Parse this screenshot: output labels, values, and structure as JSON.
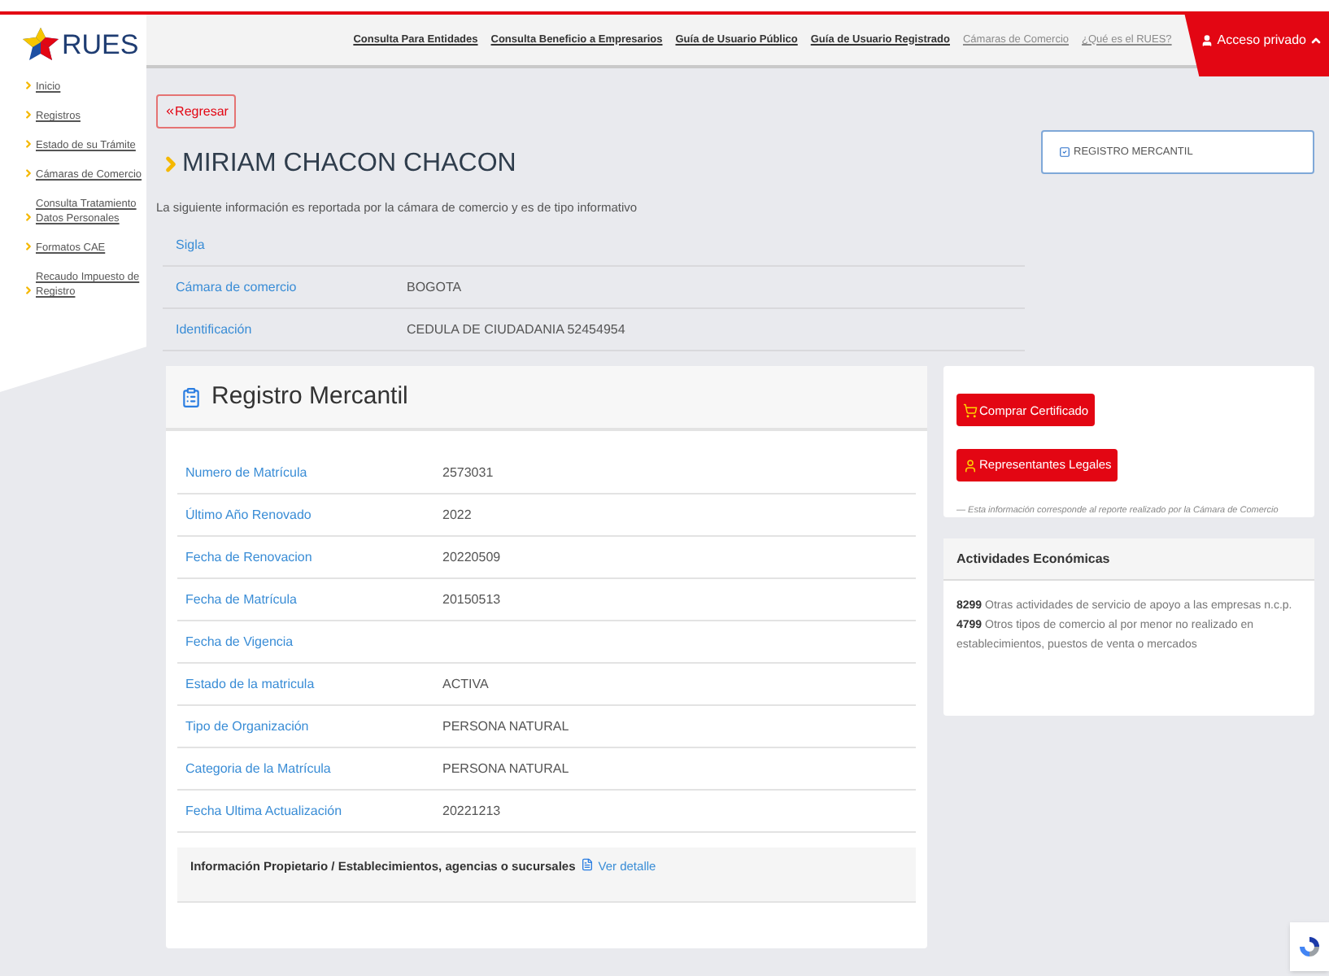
{
  "logo": {
    "text": "RUES"
  },
  "nav_links": [
    {
      "label": "Consulta Para Entidades",
      "muted": false
    },
    {
      "label": "Consulta Beneficio a Empresarios",
      "muted": false
    },
    {
      "label": "Guía de Usuario Público",
      "muted": false
    },
    {
      "label": "Guía de Usuario Registrado",
      "muted": false
    },
    {
      "label": "Cámaras de Comercio",
      "muted": true
    },
    {
      "label": "¿Qué es el RUES?",
      "muted": true
    }
  ],
  "private_access": {
    "label": "Acceso privado"
  },
  "sidebar": {
    "items": [
      {
        "label": "Inicio"
      },
      {
        "label": "Registros"
      },
      {
        "label": "Estado de su Trámite"
      },
      {
        "label": "Cámaras de Comercio"
      },
      {
        "label": "Consulta Tratamiento Datos Personales"
      },
      {
        "label": "Formatos CAE"
      },
      {
        "label": "Recaudo Impuesto de Registro"
      }
    ]
  },
  "back_button": {
    "label": "Regresar"
  },
  "title": "MIRIAM CHACON CHACON",
  "description": "La siguiente información es reportada por la cámara de comercio y es de tipo informativo",
  "summary_rows": [
    {
      "label": "Sigla"
    },
    {
      "label": "Cámara de comercio",
      "value": "BOGOTA"
    },
    {
      "label": "Identificación",
      "value": "CEDULA DE CIUDADANIA 52454954"
    }
  ],
  "filter": {
    "label": "REGISTRO MERCANTIL",
    "checked": true
  },
  "registro": {
    "title": "Registro Mercantil",
    "rows": [
      {
        "label": "Numero de Matrícula",
        "value": "2573031"
      },
      {
        "label": "Último Año Renovado",
        "value": "2022"
      },
      {
        "label": "Fecha de Renovacion",
        "value": "20220509"
      },
      {
        "label": "Fecha de Matrícula",
        "value": "20150513"
      },
      {
        "label": "Fecha de Vigencia"
      },
      {
        "label": "Estado de la matricula",
        "value": "ACTIVA"
      },
      {
        "label": "Tipo de Organización",
        "value": "PERSONA NATURAL"
      },
      {
        "label": "Categoria de la Matrícula",
        "value": "PERSONA NATURAL"
      },
      {
        "label": "Fecha Ultima Actualización",
        "value": "20221213"
      }
    ],
    "footer": {
      "text": "Información Propietario / Establecimientos, agencias o sucursales",
      "link": "Ver detalle"
    }
  },
  "actions": {
    "buttons": [
      {
        "label": "Comprar Certificado",
        "kind": "cart"
      },
      {
        "label": "Representantes Legales",
        "kind": "person"
      }
    ],
    "note": "— Esta información corresponde al reporte realizado por la Cámara de Comercio"
  },
  "activities": {
    "title": "Actividades Económicas",
    "items": [
      {
        "code": "8299",
        "text": "Otras actividades de servicio de apoyo a las empresas n.c.p."
      },
      {
        "code": "4799",
        "text": "Otros tipos de comercio al por menor no realizado en establecimientos, puestos de venta o mercados"
      }
    ]
  }
}
